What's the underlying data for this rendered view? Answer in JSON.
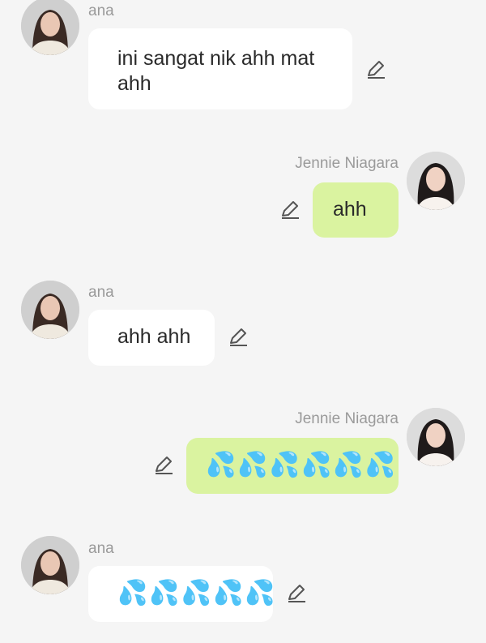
{
  "messages": [
    {
      "sender": "ana",
      "side": "in",
      "text": "ini sangat nik ahh mat ahh"
    },
    {
      "sender": "Jennie Niagara",
      "side": "out",
      "text": "ahh"
    },
    {
      "sender": "ana",
      "side": "in",
      "text": "ahh ahh"
    },
    {
      "sender": "Jennie Niagara",
      "side": "out",
      "text": "💦💦💦💦💦💦"
    },
    {
      "sender": "ana",
      "side": "in",
      "text": "💦💦💦💦💦"
    }
  ],
  "icons": {
    "edit": "pencil-edit-icon",
    "avatar": "user-avatar"
  },
  "colors": {
    "background": "#f5f5f5",
    "incoming_bubble": "#ffffff",
    "outgoing_bubble": "#daf3a0",
    "sender_name": "#9a9a9a",
    "drops": "#49b7e8"
  }
}
